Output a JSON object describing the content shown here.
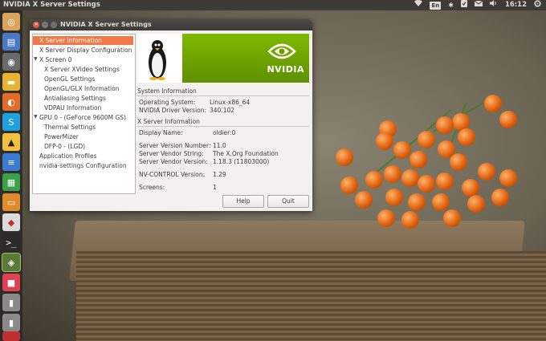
{
  "top_panel": {
    "app_title": "NVIDIA X Server Settings",
    "keyboard_layout": "En",
    "clock": "16:12"
  },
  "window": {
    "title": "NVIDIA X Server Settings"
  },
  "tree": {
    "items": [
      {
        "label": "X Server Information",
        "selected": true
      },
      {
        "label": "X Server Display Configuration"
      },
      {
        "label": "X Screen 0"
      },
      {
        "label": "X Server XVideo Settings"
      },
      {
        "label": "OpenGL Settings"
      },
      {
        "label": "OpenGL/GLX Information"
      },
      {
        "label": "Antialiasing Settings"
      },
      {
        "label": "VDPAU Information"
      },
      {
        "label": "GPU 0 - (GeForce 9600M GS)"
      },
      {
        "label": "Thermal Settings"
      },
      {
        "label": "PowerMizer"
      },
      {
        "label": "DFP-0 - (LGD)"
      },
      {
        "label": "Application Profiles"
      },
      {
        "label": "nvidia-settings Configuration"
      }
    ]
  },
  "banner": {
    "brand_text": "NVIDIA",
    "colors": {
      "green": "#76b900"
    }
  },
  "system_info": {
    "heading": "System Information",
    "os_label": "Operating System:",
    "os_value": "Linux-x86_64",
    "driver_label": "NVIDIA Driver Version:",
    "driver_value": "340.102"
  },
  "xserver_info": {
    "heading": "X Server Information",
    "display_label": "Display Name:",
    "display_value": "oldier:0",
    "version_label": "Server Version Number:",
    "version_value": "11.0",
    "vendor_label": "Server Vendor String:",
    "vendor_value": "The X.Org Foundation",
    "vendor_version_label": "Server Vendor Version:",
    "vendor_version_value": "1.18.3 (11803000)",
    "nvcontrol_label": "NV-CONTROL Version:",
    "nvcontrol_value": "1.29",
    "screens_label": "Screens:",
    "screens_value": "1"
  },
  "buttons": {
    "help": "Help",
    "quit": "Quit"
  },
  "launcher_icons": [
    "ubuntu-icon",
    "files-icon",
    "disk-icon",
    "folder-icon",
    "firefox-icon",
    "skype-icon",
    "inkscape-icon",
    "writer-icon",
    "calc-icon",
    "impress-icon",
    "software-center-icon",
    "terminal-icon",
    "nvidia-icon",
    "app-icon",
    "usb-drive-icon",
    "usb-drive-icon-2",
    "trash-icon"
  ]
}
